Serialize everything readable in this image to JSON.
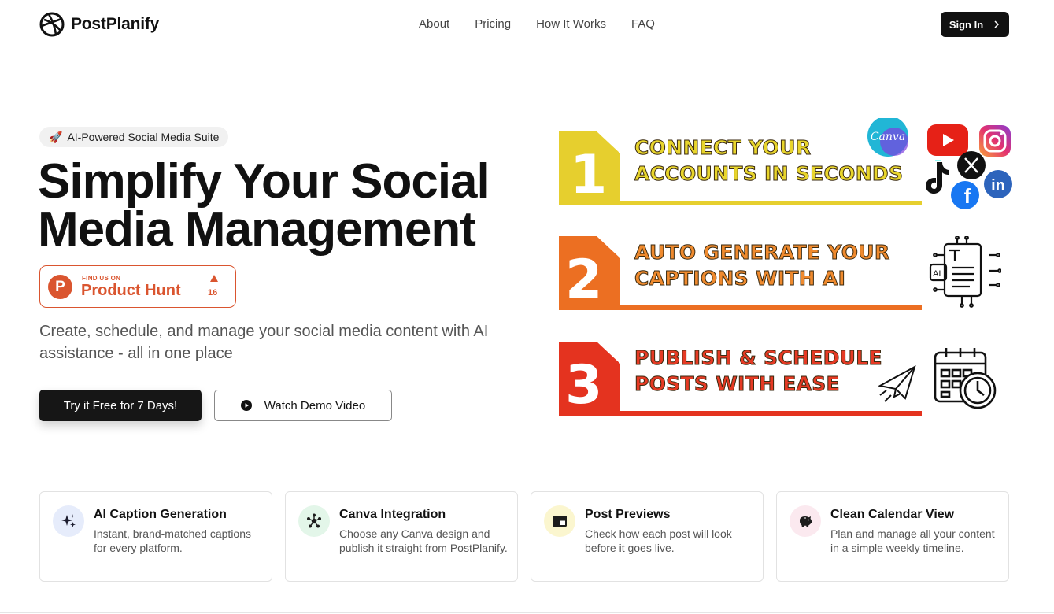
{
  "brand": {
    "name": "PostPlanify"
  },
  "nav": {
    "items": [
      "About",
      "Pricing",
      "How It Works",
      "FAQ"
    ],
    "signin_label": "Sign In"
  },
  "hero": {
    "badge_icon": "rocket-icon",
    "badge": "AI-Powered Social Media Suite",
    "title_line1": "Simplify Your Social",
    "title_line2": "Media Management",
    "subtitle": "Create, schedule, and manage your social media content with AI assistance - all in one place",
    "primary_cta": "Try it Free for 7 Days!",
    "secondary_cta": "Watch Demo Video"
  },
  "product_hunt": {
    "letter": "P",
    "small": "FIND US ON",
    "big": "Product Hunt",
    "count": "16"
  },
  "steps": [
    {
      "num": "1",
      "line1": "CONNECT YOUR",
      "line2": "ACCOUNTS IN SECONDS",
      "color": "#e6cf2e",
      "text_color": "#e8d52c"
    },
    {
      "num": "2",
      "line1": "AUTO GENERATE YOUR",
      "line2": "CAPTIONS WITH AI",
      "color": "#ec6f22",
      "text_color": "#ef8a2e"
    },
    {
      "num": "3",
      "line1": "PUBLISH & SCHEDULE",
      "line2": "POSTS WITH EASE",
      "color": "#e4331f",
      "text_color": "#e63a24"
    }
  ],
  "social_icons": {
    "canva": "Canva",
    "linkedin": "in",
    "facebook": "f"
  },
  "features": [
    {
      "title": "AI Caption Generation",
      "desc": "Instant, brand-matched captions for every platform.",
      "icon": "sparkles-icon",
      "bg": "#e6ecfb"
    },
    {
      "title": "Canva Integration",
      "desc": "Choose any Canva design and publish it straight from PostPlanify.",
      "icon": "network-icon",
      "bg": "#e3f6e9"
    },
    {
      "title": "Post Previews",
      "desc": "Check how each post will look before it goes live.",
      "icon": "preview-icon",
      "bg": "#fbf6cf"
    },
    {
      "title": "Clean Calendar View",
      "desc": "Plan and manage all your content in a simple weekly timeline.",
      "icon": "piggy-bank-icon",
      "bg": "#fbe9ef"
    }
  ]
}
